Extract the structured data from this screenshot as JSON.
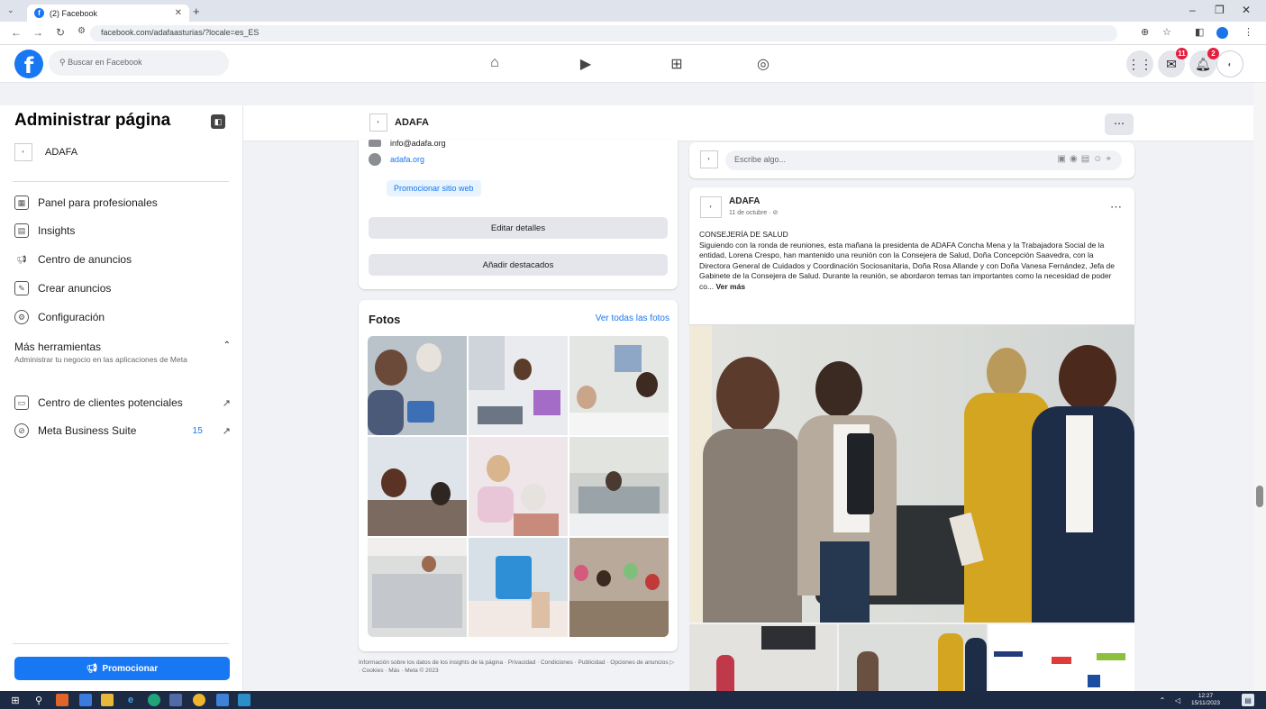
{
  "browser": {
    "tab_title": "(2) Facebook",
    "tab_close": "✕",
    "new_tab": "+",
    "url": "facebook.com/adafaasturias/?locale=es_ES"
  },
  "fbnav": {
    "search_placeholder": "Buscar en Facebook",
    "messenger_badge": "11",
    "notifications_badge": "2"
  },
  "sidebar": {
    "title": "Administrar página",
    "page_name": "ADAFA",
    "items": [
      {
        "label": "Panel para profesionales",
        "icon": "dashboard-icon"
      },
      {
        "label": "Insights",
        "icon": "insights-icon"
      },
      {
        "label": "Centro de anuncios",
        "icon": "megaphone-icon"
      },
      {
        "label": "Crear anuncios",
        "icon": "pencil-icon"
      },
      {
        "label": "Configuración",
        "icon": "gear-icon"
      }
    ],
    "more_tools_title": "Más herramientas",
    "more_tools_desc": "Administrar tu negocio en las aplicaciones de Meta",
    "tools": [
      {
        "label": "Centro de clientes potenciales",
        "tag": ""
      },
      {
        "label": "Meta Business Suite",
        "tag": "15"
      }
    ],
    "promote_label": "Promocionar"
  },
  "strip": {
    "page_name": "ADAFA",
    "menu": "⋯"
  },
  "intro": {
    "partial_text": "info@adafa.org",
    "website": "adafa.org",
    "promote_site": "Promocionar sitio web",
    "edit_details": "Editar detalles",
    "add_featured": "Añadir destacados"
  },
  "photos": {
    "title": "Fotos",
    "see_all": "Ver todas las fotos"
  },
  "footer": "Información sobre los datos de los insights de la página · Privacidad · Condiciones · Publicidad · Opciones de anuncios ▷ · Cookies · Más · Meta © 2023",
  "composer": {
    "placeholder": "Escribe algo..."
  },
  "post": {
    "author": "ADAFA",
    "date": "11 de octubre · ⊘",
    "text": "CONSEJERÍA DE SALUD\nSiguiendo con la ronda de reuniones, esta mañana la presidenta de ADAFA Concha Mena y la Trabajadora Social de la entidad, Lorena Crespo, han mantenido una reunión con la Consejera de Salud, Doña Concepción Saavedra, con la Directora General de Cuidados y Coordinación Sociosanitaria, Doña Rosa Allande y con Doña Vanesa Fernández, Jefa de Gabinete de la Consejera de Salud. Durante la reunión, se abordaron temas tan importantes como la necesidad de poder co...",
    "see_more": "Ver más"
  },
  "taskbar": {
    "time": "12:27",
    "date": "15/11/2023"
  },
  "colors": {
    "fb_blue": "#1877f2",
    "badge_red": "#e41e3f"
  }
}
